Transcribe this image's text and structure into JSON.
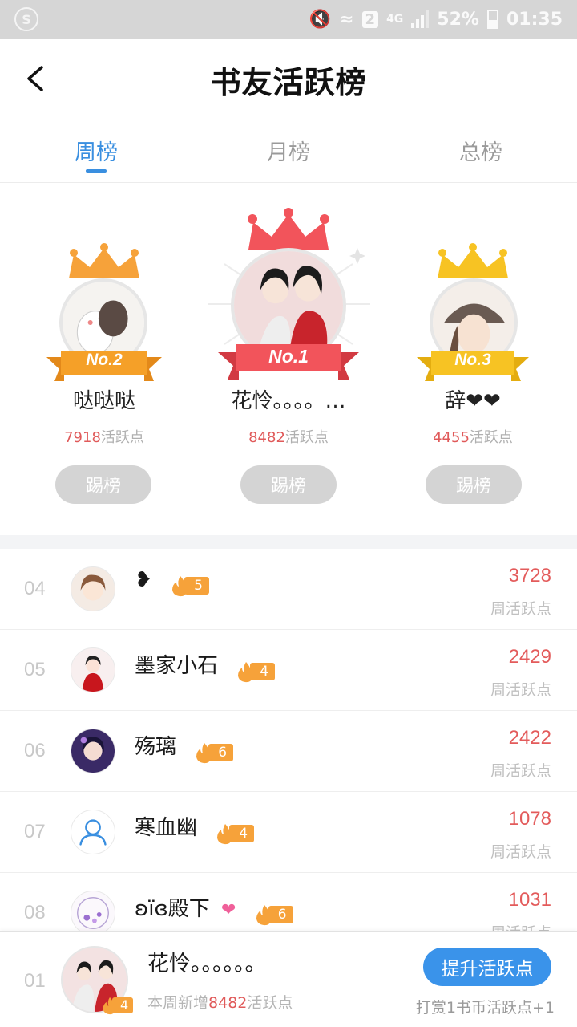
{
  "status_bar": {
    "network_badge": "2",
    "network_type": "4G",
    "battery": "52%",
    "time": "01:35"
  },
  "header": {
    "title": "书友活跃榜"
  },
  "tabs": [
    {
      "label": "周榜",
      "active": true
    },
    {
      "label": "月榜",
      "active": false
    },
    {
      "label": "总榜",
      "active": false
    }
  ],
  "podium": {
    "first": {
      "rank_label": "No.1",
      "name": "花怜。。。。…",
      "points": "8482",
      "points_suffix": "活跃点",
      "button": "踢榜",
      "ribbon_color": "#f2545b"
    },
    "second": {
      "rank_label": "No.2",
      "name": "哒哒哒",
      "points": "7918",
      "points_suffix": "活跃点",
      "button": "踢榜",
      "ribbon_color": "#f5a028"
    },
    "third": {
      "rank_label": "No.3",
      "name": "辞❤❤",
      "points": "4455",
      "points_suffix": "活跃点",
      "button": "踢榜",
      "ribbon_color": "#f7c323"
    }
  },
  "list": [
    {
      "rank": "04",
      "name": "❥",
      "level": "5",
      "score": "3728",
      "score_label": "周活跃点"
    },
    {
      "rank": "05",
      "name": "墨家小石",
      "level": "4",
      "score": "2429",
      "score_label": "周活跃点"
    },
    {
      "rank": "06",
      "name": "殇璃",
      "level": "6",
      "score": "2422",
      "score_label": "周活跃点"
    },
    {
      "rank": "07",
      "name": "寒血幽",
      "level": "4",
      "score": "1078",
      "score_label": "周活跃点"
    },
    {
      "rank": "08",
      "name": "ʚїɞ殿下",
      "level": "6",
      "score": "1031",
      "score_label": "周活跃点"
    }
  ],
  "my_entry": {
    "rank": "01",
    "name": "花怜。。。。。。",
    "level": "4",
    "sub_prefix": "本周新增",
    "sub_points": "8482",
    "sub_suffix": "活跃点",
    "button": "提升活跃点",
    "hint": "打赏1书币活跃点+1"
  },
  "colors": {
    "accent": "#3a8fe0",
    "score_red": "#e35b5b",
    "level_orange": "#f6a23a",
    "kick_gray": "#d4d4d4",
    "boost_blue": "#3a93ea"
  }
}
